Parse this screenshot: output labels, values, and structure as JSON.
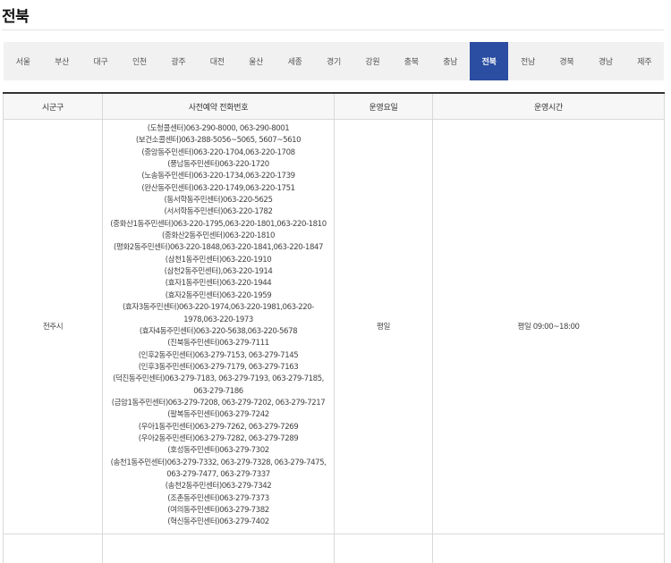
{
  "page": {
    "title": "전북"
  },
  "tabs": [
    {
      "label": "서울",
      "active": false
    },
    {
      "label": "부산",
      "active": false
    },
    {
      "label": "대구",
      "active": false
    },
    {
      "label": "인천",
      "active": false
    },
    {
      "label": "광주",
      "active": false
    },
    {
      "label": "대전",
      "active": false
    },
    {
      "label": "울산",
      "active": false
    },
    {
      "label": "세종",
      "active": false
    },
    {
      "label": "경기",
      "active": false
    },
    {
      "label": "강원",
      "active": false
    },
    {
      "label": "충북",
      "active": false
    },
    {
      "label": "충남",
      "active": false
    },
    {
      "label": "전북",
      "active": true
    },
    {
      "label": "전남",
      "active": false
    },
    {
      "label": "경북",
      "active": false
    },
    {
      "label": "경남",
      "active": false
    },
    {
      "label": "제주",
      "active": false
    }
  ],
  "table": {
    "headers": [
      "시군구",
      "사전예약 전화번호",
      "운영요일",
      "운영시간"
    ],
    "rows": [
      {
        "district": "전주시",
        "phones": [
          "(도청콜센터)063-290-8000, 063-290-8001",
          "(보건소콜센터)063-288-5056~5065, 5607~5610",
          "(중앙동주민센터)063-220-1704,063-220-1708",
          "(풍남동주민센터)063-220-1720",
          "(노송동주민센터)063-220-1734,063-220-1739",
          "(완산동주민센터)063-220-1749,063-220-1751",
          "(동서학동주민센터)063-220-5625",
          "(서서학동주민센터)063-220-1782",
          "(중화산1동주민센터)063-220-1795,063-220-1801,063-220-1810",
          "(중화산2동주민센터)063-220-1810",
          "(평화2동주민센터)063-220-1848,063-220-1841,063-220-1847",
          "(삼천1동주민센터)063-220-1910",
          "(삼천2동주민센터),063-220-1914",
          "(효자1동주민센터)063-220-1944",
          "(효자2동주민센터)063-220-1959",
          "(효자3동주민센터)063-220-1974,063-220-1981,063-220-",
          "1978,063-220-1973",
          "(효자4동주민센터)063-220-5638,063-220-5678",
          "(진북동주민센터)063-279-7111",
          "(인후2동주민센터)063-279-7153, 063-279-7145",
          "(인후3동주민센터)063-279-7179, 063-279-7163",
          "(덕진동주민센터)063-279-7183, 063-279-7193, 063-279-7185,",
          "063-279-7186",
          "(금암1동주민센터)063-279-7208, 063-279-7202, 063-279-7217",
          "(팔복동주민센터)063-279-7242",
          "(우아1동주민센터)063-279-7262, 063-279-7269",
          "(우아2동주민센터)063-279-7282, 063-279-7289",
          "(호성동주민센터)063-279-7302",
          "(송천1동주민센터)063-279-7332, 063-279-7328, 063-279-7475,",
          "063-279-7477, 063-279-7337",
          "(송천2동주민센터)063-279-7342",
          "(조촌동주민센터)063-279-7373",
          "(여의동주민센터)063-279-7382",
          "(혁신동주민센터)063-279-7402"
        ],
        "days": "평일",
        "hours": "평일 09:00~18:00"
      }
    ]
  },
  "colors": {
    "active_tab": "#2b4ea2",
    "tab_bar": "#f1f1f1",
    "header_bg": "#f7f7f7",
    "border": "#d9d9d9"
  }
}
